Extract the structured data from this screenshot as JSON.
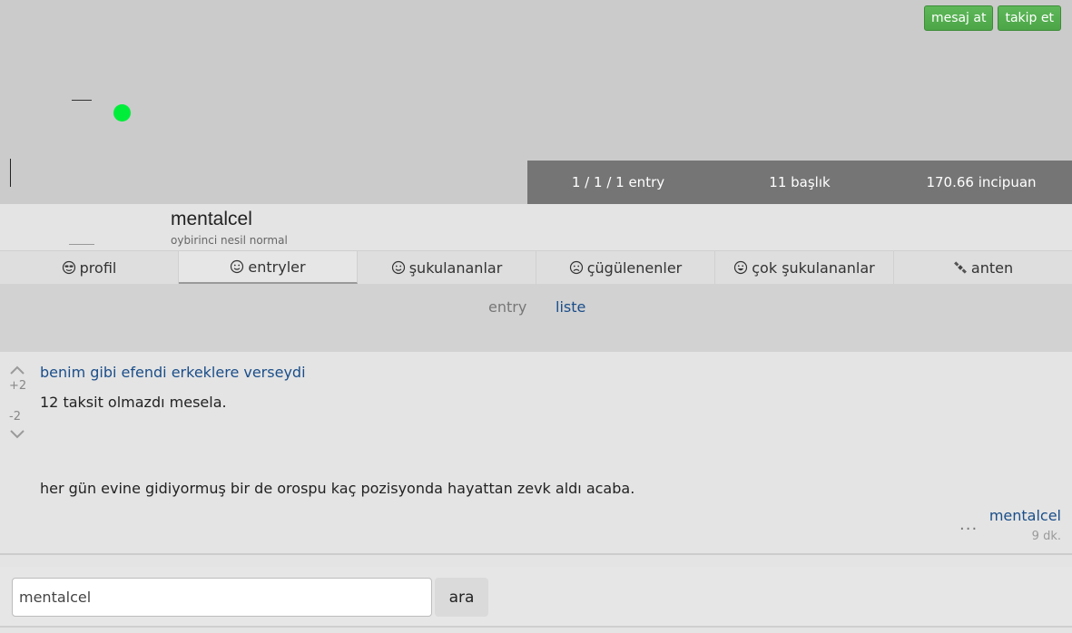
{
  "header": {
    "message_button": "mesaj at",
    "follow_button": "takip et",
    "stats": {
      "entries": "1 / 1 / 1 entry",
      "titles": "11 başlık",
      "points": "170.66 incipuan"
    }
  },
  "profile": {
    "nick": "mentalcel",
    "rank": "oybirinci nesil normal"
  },
  "tabs": [
    {
      "label": "profil",
      "icon": "cool-face-icon"
    },
    {
      "label": "entryler",
      "icon": "smile-face-icon",
      "active": true
    },
    {
      "label": "şukulananlar",
      "icon": "smile-face-icon"
    },
    {
      "label": "çügülenenler",
      "icon": "sad-face-icon"
    },
    {
      "label": "çok şukulananlar",
      "icon": "grin-face-icon"
    },
    {
      "label": "anten",
      "icon": "satellite-icon"
    }
  ],
  "subtabs": {
    "entry": "entry",
    "liste": "liste"
  },
  "entry": {
    "title": "benim gibi efendi erkeklere verseydi",
    "upvotes": "+2",
    "downvotes": "-2",
    "line1": "12 taksit olmazdı mesela.",
    "line2": "her gün evine gidiyormuş bir de orospu kaç pozisyonda hayattan zevk aldı acaba.",
    "menu": "...",
    "author": "mentalcel",
    "time": "9 dk."
  },
  "search": {
    "value": "mentalcel",
    "button": "ara"
  },
  "colors": {
    "accent_green": "#4ca647",
    "link_blue": "#1a4e8a",
    "stats_bg": "#757575",
    "status_dot": "#00ee3a"
  }
}
